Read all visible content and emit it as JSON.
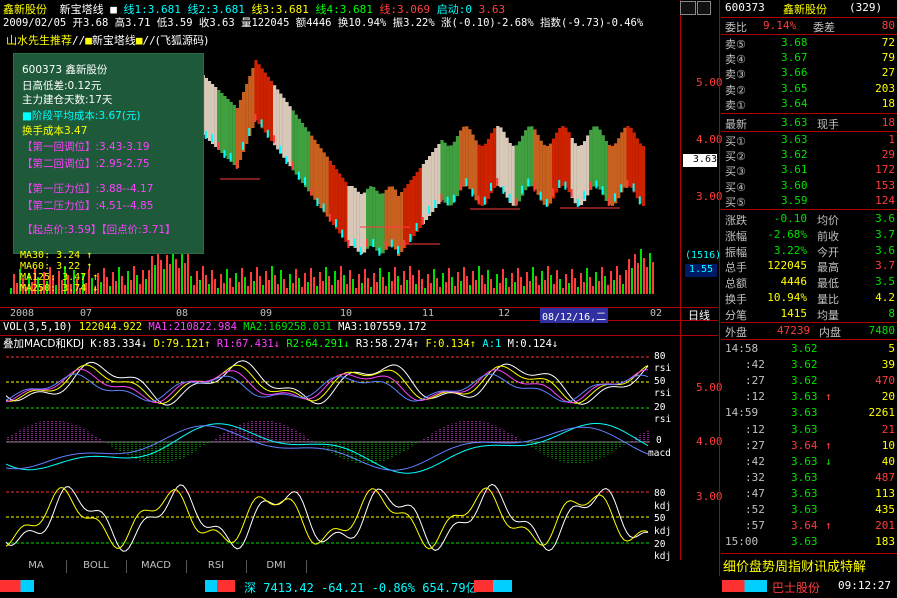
{
  "header": {
    "stock_name": "鑫新股份",
    "indicator_name": "新宝塔线",
    "lines": [
      {
        "label": "线1:3.681",
        "color": "#00ffff"
      },
      {
        "label": "线2:3.681",
        "color": "#00ffff"
      },
      {
        "label": "线3:3.681",
        "color": "#ffff00"
      },
      {
        "label": "线4:3.681",
        "color": "#00ff00"
      },
      {
        "label": "线:3.069",
        "color": "#ff4040"
      },
      {
        "label": "启动:0",
        "color": "#00ffff"
      },
      {
        "label": "3.63",
        "color": "#ff4040"
      }
    ],
    "ohlc_line": "2009/02/05 开3.68 高3.71 低3.59 收3.63 量122045 额4446 换10.94% 振3.22% 涨(-0.10)-2.68% 指数(-9.73)-0.46%",
    "sub_title_1": "山水先生推荐",
    "sub_title_2": "新宝塔线",
    "sub_title_3": "(飞狐源码)"
  },
  "info_box": {
    "lines": [
      {
        "text": "600373 鑫新股份",
        "color": "#ffffff"
      },
      {
        "text": "日高低差:0.12元",
        "color": "#ffffff"
      },
      {
        "text": "主力建仓天数:17天",
        "color": "#ffffff"
      },
      {
        "text": "■阶段平均成本:3.67(元)",
        "color": "#00ffff"
      },
      {
        "text": "换手成本3.47",
        "color": "#ffff00"
      },
      {
        "text": "【第一回调位】:3.43-3.19",
        "color": "#ff40ff"
      },
      {
        "text": "【第二回调位】:2.95-2.75",
        "color": "#ff40ff"
      },
      {
        "text": "【第一压力位】:3.88--4.17",
        "color": "#ff40ff"
      },
      {
        "text": "【第二压力位】:4.51--4.85",
        "color": "#ff40ff"
      },
      {
        "text": "【起点价:3.59】【回点价:3.71】",
        "color": "#ff40ff"
      }
    ]
  },
  "ma_labels": [
    {
      "text": "MA30: 3.24 ↑",
      "color": "#ffff00"
    },
    {
      "text": "MA60: 3.22 ↑",
      "color": "#ffff00"
    },
    {
      "text": "MA125: 3.47 ↑",
      "color": "#ffff00"
    },
    {
      "text": "MA250: 3.74 ↓",
      "color": "#ffff00"
    }
  ],
  "price_axis": [
    "5.00",
    "4.00",
    "3.00"
  ],
  "current_price_tag": "3.63",
  "vol_tag_1": "(1516)",
  "vol_tag_2": "1.55",
  "date_axis": [
    "2008",
    "07",
    "08",
    "09",
    "10",
    "11",
    "12",
    "08/12/16,二",
    "02"
  ],
  "period_label": "日线",
  "vol_line": {
    "label": "VOL(3,5,10)",
    "v1": "122044.922",
    "v2": "MA1:210822.984",
    "v3": "MA2:169258.031",
    "v4": "MA3:107559.172"
  },
  "macd_line": {
    "label": "叠加MACD和KDJ",
    "items": [
      {
        "text": "K:83.334↓",
        "color": "#ffffff"
      },
      {
        "text": "D:79.121↑",
        "color": "#ffff00"
      },
      {
        "text": "R1:67.431↓",
        "color": "#ff40ff"
      },
      {
        "text": "R2:64.291↓",
        "color": "#00ff00"
      },
      {
        "text": "R3:58.274↑",
        "color": "#ffffff"
      },
      {
        "text": "F:0.134↑",
        "color": "#ffff00"
      },
      {
        "text": "A:1",
        "color": "#00ffff"
      },
      {
        "text": "M:0.124↓",
        "color": "#ffffff"
      }
    ]
  },
  "indicator_axis": {
    "rsi_labels": [
      "80",
      "rsi",
      "50",
      "rsi",
      "20",
      "rsi"
    ],
    "macd_labels": [
      "0",
      "macd"
    ],
    "kdj_labels": [
      "80",
      "kdj",
      "50",
      "kdj",
      "20",
      "kdj"
    ],
    "right_values": [
      "5.00",
      "4.00",
      "3.00"
    ]
  },
  "bottom_tabs": [
    "MA",
    "BOLL",
    "MACD",
    "RSI",
    "DMI"
  ],
  "quote": {
    "code": "600373",
    "name": "鑫新股份",
    "id": "(329)",
    "webi": {
      "label": "委比",
      "value": "9.14%"
    },
    "weicha": {
      "label": "委差",
      "value": "80"
    },
    "asks": [
      {
        "label": "卖⑤",
        "price": "3.68",
        "vol": "72"
      },
      {
        "label": "卖④",
        "price": "3.67",
        "vol": "79"
      },
      {
        "label": "卖③",
        "price": "3.66",
        "vol": "27"
      },
      {
        "label": "卖②",
        "price": "3.65",
        "vol": "203"
      },
      {
        "label": "卖①",
        "price": "3.64",
        "vol": "18"
      }
    ],
    "latest": {
      "label": "最新",
      "price": "3.63",
      "hand_label": "现手",
      "hand": "18"
    },
    "bids": [
      {
        "label": "买①",
        "price": "3.63",
        "vol": "1"
      },
      {
        "label": "买②",
        "price": "3.62",
        "vol": "29"
      },
      {
        "label": "买③",
        "price": "3.61",
        "vol": "172"
      },
      {
        "label": "买④",
        "price": "3.60",
        "vol": "153"
      },
      {
        "label": "买⑤",
        "price": "3.59",
        "vol": "124"
      }
    ],
    "stats": [
      {
        "l1": "涨跌",
        "v1": "-0.10",
        "l2": "均价",
        "v2": "3.6"
      },
      {
        "l1": "涨幅",
        "v1": "-2.68%",
        "l2": "前收",
        "v2": "3.7"
      },
      {
        "l1": "振幅",
        "v1": "3.22%",
        "l2": "今开",
        "v2": "3.6"
      },
      {
        "l1": "总手",
        "v1": "122045",
        "l2": "最高",
        "v2": "3.7"
      },
      {
        "l1": "总额",
        "v1": "4446",
        "l2": "最低",
        "v2": "3.5"
      },
      {
        "l1": "换手",
        "v1": "10.94%",
        "l2": "量比",
        "v2": "4.2"
      },
      {
        "l1": "分笔",
        "v1": "1415",
        "l2": "均量",
        "v2": "8"
      }
    ],
    "outer": {
      "label": "外盘",
      "value": "47239",
      "inner_label": "内盘",
      "inner_value": "7480"
    },
    "ticks": [
      {
        "time": "14:58",
        "price": "3.62",
        "vol": "5",
        "arrow": ""
      },
      {
        "time": ":42",
        "price": "3.62",
        "vol": "39",
        "arrow": ""
      },
      {
        "time": ":27",
        "price": "3.62",
        "vol": "470",
        "arrow": ""
      },
      {
        "time": ":12",
        "price": "3.63",
        "vol": "20",
        "arrow": "↑"
      },
      {
        "time": "14:59",
        "price": "3.63",
        "vol": "2261",
        "arrow": ""
      },
      {
        "time": ":12",
        "price": "3.63",
        "vol": "21",
        "arrow": ""
      },
      {
        "time": ":27",
        "price": "3.64",
        "vol": "10",
        "arrow": "↑"
      },
      {
        "time": ":42",
        "price": "3.63",
        "vol": "40",
        "arrow": "↓"
      },
      {
        "time": ":32",
        "price": "3.63",
        "vol": "487",
        "arrow": ""
      },
      {
        "time": ":47",
        "price": "3.63",
        "vol": "113",
        "arrow": ""
      },
      {
        "time": ":52",
        "price": "3.63",
        "vol": "435",
        "arrow": ""
      },
      {
        "time": ":57",
        "price": "3.64",
        "vol": "201",
        "arrow": "↑"
      },
      {
        "time": "15:00",
        "price": "3.63",
        "vol": "183",
        "arrow": ""
      }
    ],
    "bottom_tabs": "细价盘势周指财讯成特解"
  },
  "status": {
    "index_label": "深",
    "index_value": "7413.42",
    "index_change": "-64.21",
    "index_pct": "-0.86%",
    "index_amount": "654.79亿",
    "right_name": "巴士股份",
    "time": "09:12:27"
  }
}
